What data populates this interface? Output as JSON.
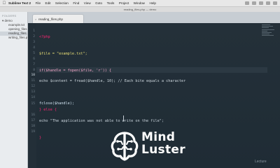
{
  "menubar": {
    "apple": "",
    "items": [
      "Sublime Text 2",
      "File",
      "Edit",
      "Selection",
      "Find",
      "View",
      "Goto",
      "Tools",
      "Project",
      "Window",
      "Help"
    ]
  },
  "window": {
    "title": "reading_files.php — demo"
  },
  "tabs": [
    {
      "label": "reading_files.php",
      "close": "×"
    }
  ],
  "sidebar": {
    "header": "FOLDERS",
    "items": [
      {
        "label": "▾ demo"
      },
      {
        "label": "example.txt"
      },
      {
        "label": "opening_files.php"
      },
      {
        "label": "reading_files.php"
      },
      {
        "label": "writing_files.php"
      }
    ]
  },
  "editor": {
    "lines": [
      {
        "n": "1",
        "text": "<?php"
      },
      {
        "n": "2",
        "text": ""
      },
      {
        "n": "3",
        "text": ""
      },
      {
        "n": "4",
        "text": "$file = \"example.txt\";"
      },
      {
        "n": "5",
        "text": ""
      },
      {
        "n": "6",
        "text": ""
      },
      {
        "n": "7",
        "text": "if($handle = fopen($file, 'r')) {"
      },
      {
        "n": "8",
        "text": ""
      },
      {
        "n": "9",
        "text": ""
      },
      {
        "n": "10",
        "text": "echo $content = fread($handle, 10); // Each bite equals a character"
      },
      {
        "n": "11",
        "text": ""
      },
      {
        "n": "12",
        "text": ""
      },
      {
        "n": "13",
        "text": ""
      },
      {
        "n": "14",
        "text": "fclose($handle);"
      },
      {
        "n": "15",
        "text": "} else {"
      },
      {
        "n": "16",
        "text": "echo \"The application was not able to write on the file\";"
      },
      {
        "n": "17",
        "text": ""
      },
      {
        "n": "18",
        "text": ""
      },
      {
        "n": "19",
        "text": "}"
      }
    ]
  },
  "branding": {
    "line1": "Mind",
    "line2": "Luster"
  },
  "watermark": "Lecture"
}
